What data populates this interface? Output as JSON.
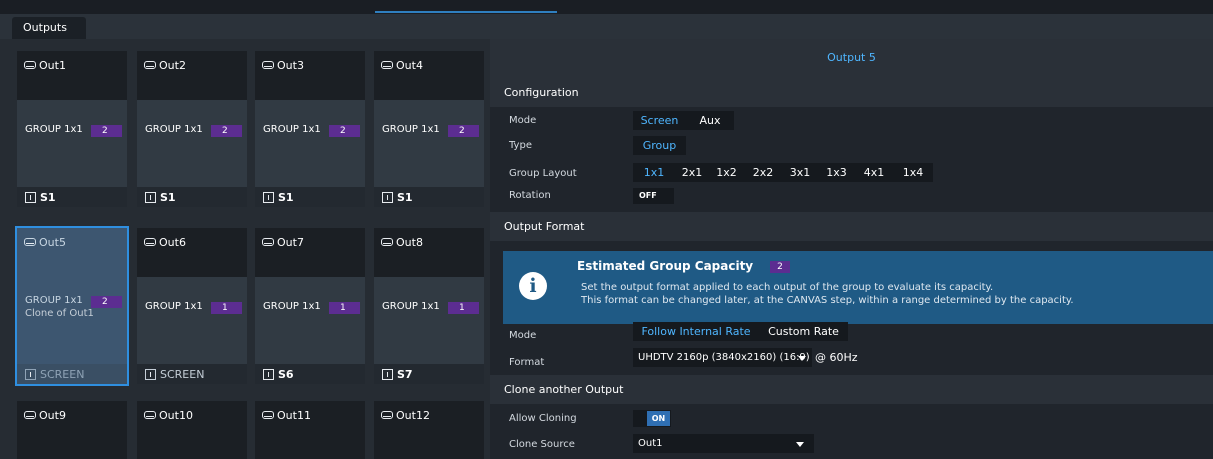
{
  "tabs": [
    "Outputs"
  ],
  "outputs": [
    {
      "name": "Out1",
      "group": "GROUP 1x1",
      "count": "2",
      "slot": "S1",
      "clone": ""
    },
    {
      "name": "Out2",
      "group": "GROUP 1x1",
      "count": "2",
      "slot": "S1",
      "clone": ""
    },
    {
      "name": "Out3",
      "group": "GROUP 1x1",
      "count": "2",
      "slot": "S1",
      "clone": ""
    },
    {
      "name": "Out4",
      "group": "GROUP 1x1",
      "count": "2",
      "slot": "S1",
      "clone": ""
    },
    {
      "name": "Out5",
      "group": "GROUP 1x1",
      "count": "2",
      "slot": "SCREEN",
      "clone": "Clone of Out1"
    },
    {
      "name": "Out6",
      "group": "GROUP 1x1",
      "count": "1",
      "slot": "SCREEN",
      "clone": ""
    },
    {
      "name": "Out7",
      "group": "GROUP 1x1",
      "count": "1",
      "slot": "S6",
      "clone": ""
    },
    {
      "name": "Out8",
      "group": "GROUP 1x1",
      "count": "1",
      "slot": "S7",
      "clone": ""
    },
    {
      "name": "Out9",
      "group": "",
      "count": "",
      "slot": "",
      "clone": ""
    },
    {
      "name": "Out10",
      "group": "",
      "count": "",
      "slot": "",
      "clone": ""
    },
    {
      "name": "Out11",
      "group": "",
      "count": "",
      "slot": "",
      "clone": ""
    },
    {
      "name": "Out12",
      "group": "",
      "count": "",
      "slot": "",
      "clone": ""
    }
  ],
  "panel": {
    "title": "Output 5",
    "configuration": {
      "heading": "Configuration",
      "mode_label": "Mode",
      "mode_options": [
        "Screen",
        "Aux"
      ],
      "type_label": "Type",
      "type_value": "Group",
      "layout_label": "Group Layout",
      "layouts": [
        "1x1",
        "2x1",
        "1x2",
        "2x2",
        "3x1",
        "1x3",
        "4x1",
        "1x4"
      ],
      "rotation_label": "Rotation",
      "rotation_value": "OFF"
    },
    "output_format": {
      "heading": "Output Format",
      "info_title": "Estimated Group Capacity",
      "info_badge": "2",
      "info_line1": "Set the output format applied to each output of the group to evaluate its capacity.",
      "info_line2": "This format can be changed later, at the CANVAS step, within a range determined by the capacity.",
      "mode_label": "Mode",
      "mode_options": [
        "Follow Internal Rate",
        "Custom Rate"
      ],
      "format_label": "Format",
      "format_value": "UHDTV 2160p (3840x2160) (16:9)",
      "rate": "@ 60Hz"
    },
    "clone": {
      "heading": "Clone another Output",
      "allow_label": "Allow Cloning",
      "allow_value": "ON",
      "source_label": "Clone Source",
      "source_value": "Out1"
    }
  },
  "colors": {
    "accent": "#4fb6ff",
    "badge": "#5c2d91",
    "selected_border": "#2f8fe0",
    "info_bg": "#1f5a85"
  }
}
